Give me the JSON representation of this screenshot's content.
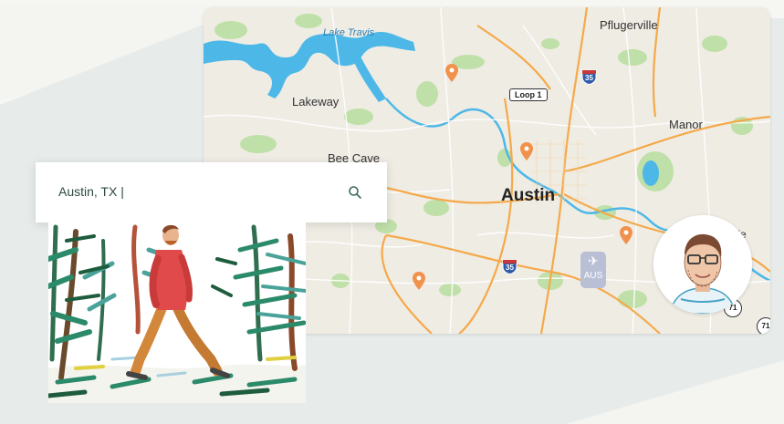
{
  "search": {
    "value": "Austin, TX |"
  },
  "map": {
    "labels": {
      "lake_travis": "Lake Travis",
      "pflugerville": "Pflugerville",
      "lakeway": "Lakeway",
      "manor": "Manor",
      "bee_cave": "Bee Cave",
      "austin": "Austin",
      "ville_partial": "ille"
    },
    "loop_badge": "Loop 1",
    "interstate_1": "35",
    "interstate_2": "35",
    "airport_code": "AUS",
    "route_71_a": "71",
    "route_71_b": "71"
  },
  "colors": {
    "water": "#4db8e8",
    "park": "#b9dca0",
    "highway": "#f5a94a",
    "pin": "#f0924c",
    "search_text": "#2e4a42",
    "accent_teal": "#3f6b5e"
  },
  "icons": {
    "search": "magnifier-icon",
    "pin": "map-pin-icon",
    "airport": "airplane-icon"
  }
}
